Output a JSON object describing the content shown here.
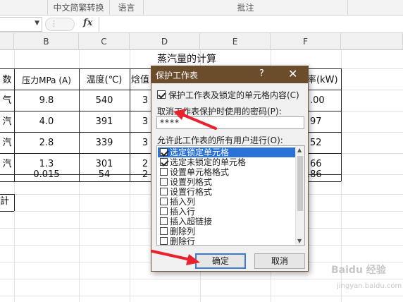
{
  "ribbon": {
    "groups": [
      "中文简繁转换",
      "语言",
      "批注"
    ]
  },
  "formula_bar": {
    "fx_label": "fx"
  },
  "columns": [
    "B",
    "C",
    "D",
    "E",
    "F"
  ],
  "sheet": {
    "title": "蒸汽量的计算",
    "headers": {
      "a_fragment": "数",
      "b": "压力MPa (A)",
      "c": "温度(℃)",
      "d_fragment": "焓值",
      "f_fragment": "率(kW)"
    },
    "rows": [
      {
        "a": "气",
        "b": "9.8",
        "c": "540",
        "d": "3",
        "f": ".00"
      },
      {
        "a": "汽",
        "b": "4.0",
        "c": "391",
        "d": "3",
        "f": "97"
      },
      {
        "a": "汽",
        "b": "2.8",
        "c": "339",
        "d": "3",
        "f": "52"
      },
      {
        "a": "汽",
        "b": "1.3",
        "c": "301",
        "d": "2",
        "f": "66"
      },
      {
        "a": "",
        "b": "0.015",
        "c": "54",
        "d": "2",
        "f": ".86"
      }
    ],
    "extra_cell": "計"
  },
  "dialog": {
    "title": "保护工作表",
    "help": "?",
    "close": "✕",
    "protect_checkbox_label": "保护工作表及锁定的单元格内容(C)",
    "protect_checked": true,
    "password_label": "取消工作表保护时使用的密码(P):",
    "password_value": "****",
    "allow_label": "允许此工作表的所有用户进行(O):",
    "permissions": [
      {
        "label": "选定锁定单元格",
        "checked": true,
        "selected": true
      },
      {
        "label": "选定未锁定的单元格",
        "checked": true,
        "selected": false
      },
      {
        "label": "设置单元格格式",
        "checked": false,
        "selected": false
      },
      {
        "label": "设置列格式",
        "checked": false,
        "selected": false
      },
      {
        "label": "设置行格式",
        "checked": false,
        "selected": false
      },
      {
        "label": "插入列",
        "checked": false,
        "selected": false
      },
      {
        "label": "插入行",
        "checked": false,
        "selected": false
      },
      {
        "label": "插入超链接",
        "checked": false,
        "selected": false
      },
      {
        "label": "删除列",
        "checked": false,
        "selected": false
      },
      {
        "label": "删除行",
        "checked": false,
        "selected": false
      }
    ],
    "ok_label": "确定",
    "cancel_label": "取消"
  },
  "watermark": {
    "brand": "Baidu 经验",
    "url": "jingyan.baidu.com"
  },
  "colors": {
    "dialog_title_bg": "#6b4d2c",
    "selection": "#2b72d6",
    "annotation_arrow": "#e8232d"
  }
}
